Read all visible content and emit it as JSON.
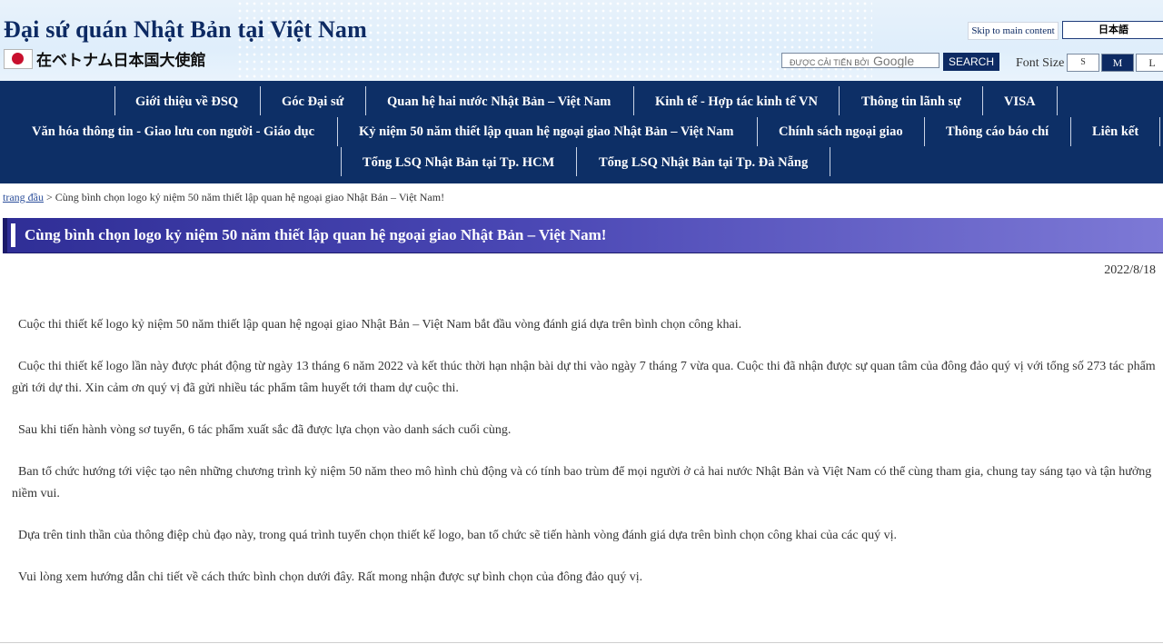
{
  "header": {
    "site_title": "Đại sứ quán Nhật Bản tại Việt Nam",
    "site_subtitle": "在ベトナム日本国大使館",
    "skip_link": "Skip to main content",
    "language_link": "日本語",
    "search_placeholder": "ĐƯỢC CẢI TIẾN BỞI",
    "search_brand": "Google",
    "search_button": "SEARCH",
    "font_size_label": "Font Size",
    "font_sizes": [
      "S",
      "M",
      "L"
    ],
    "font_size_selected": "M"
  },
  "nav": {
    "row1": [
      "Giới thiệu về ĐSQ",
      "Góc Đại sứ",
      "Quan hệ hai nước Nhật Bản – Việt Nam",
      "Kinh tế - Hợp tác kinh tế VN",
      "Thông tin lãnh sự",
      "VISA"
    ],
    "row2": [
      "Văn hóa thông tin - Giao lưu con người - Giáo dục",
      "Kỷ niệm 50 năm thiết lập quan hệ ngoại giao Nhật Bản – Việt Nam",
      "Chính sách ngoại giao",
      "Thông cáo báo chí",
      "Liên kết"
    ],
    "row3": [
      "Tổng LSQ Nhật Bản tại Tp. HCM",
      "Tổng LSQ Nhật Bản tại Tp. Đà Nẵng"
    ]
  },
  "breadcrumb": {
    "home": "trang đầu",
    "separator": ">",
    "current": "Cùng bình chọn logo kỷ niệm 50 năm thiết lập quan hệ ngoại giao Nhật Bản – Việt Nam!"
  },
  "article": {
    "title": "Cùng bình chọn logo kỷ niệm 50 năm thiết lập quan hệ ngoại giao Nhật Bản – Việt Nam!",
    "date": "2022/8/18",
    "paragraphs": [
      "Cuộc thi thiết kế logo kỷ niệm 50 năm thiết lập quan hệ ngoại giao Nhật Bản – Việt Nam bắt đầu vòng đánh giá dựa trên bình chọn công khai.",
      "Cuộc thi thiết kế logo lần này được phát động từ ngày 13 tháng 6 năm 2022 và kết thúc thời hạn nhận bài dự thi vào ngày 7 tháng 7 vừa qua. Cuộc thi đã nhận được sự quan tâm của đông đảo quý vị với tổng số 273 tác phẩm gửi tới dự thi. Xin cảm ơn quý vị đã gửi nhiều tác phẩm tâm huyết tới tham dự cuộc thi.",
      "Sau khi tiến hành vòng sơ tuyển, 6 tác phẩm xuất sắc đã được lựa chọn vào danh sách cuối cùng.",
      "Ban tổ chức hướng tới việc tạo nên những chương trình kỷ niệm 50 năm theo mô hình chủ động và có tính bao trùm để mọi người ở cả hai nước Nhật Bản và Việt Nam có thể cùng tham gia, chung tay sáng tạo và tận hưởng niềm vui.",
      "Dựa trên tinh thần của thông điệp chủ đạo này, trong quá trình tuyển chọn thiết kế logo, ban tổ chức sẽ tiến hành vòng đánh giá dựa trên bình chọn công khai của các quý vị.",
      "Vui lòng xem hướng dẫn chi tiết về cách thức bình chọn dưới đây. Rất mong nhận được sự bình chọn của đông đảo quý vị."
    ]
  }
}
